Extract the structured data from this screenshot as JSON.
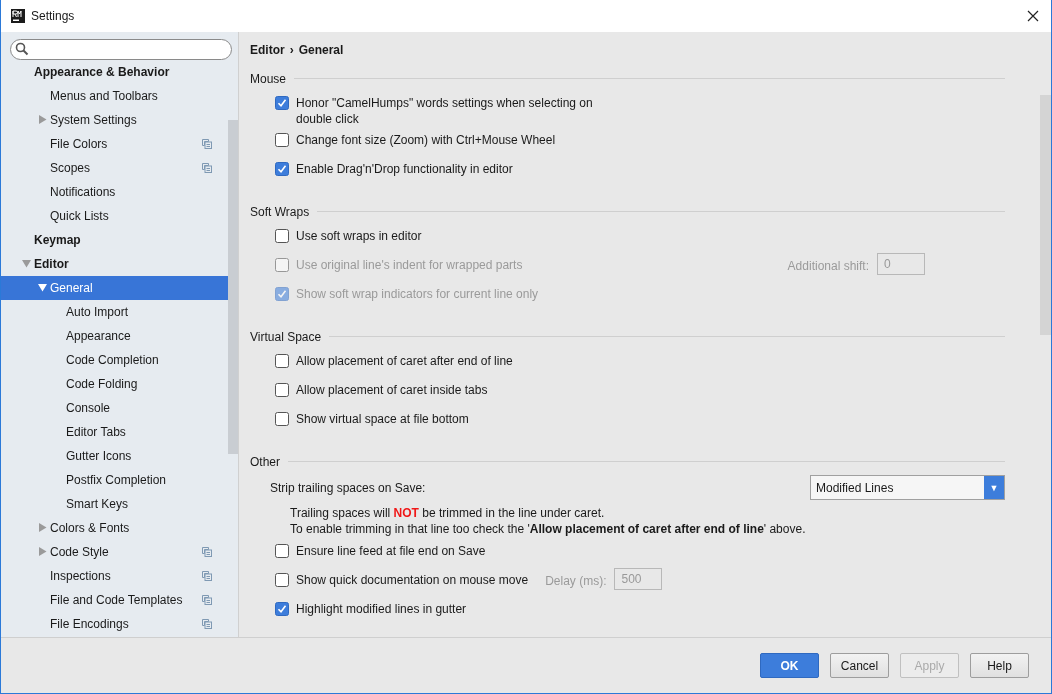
{
  "window": {
    "title": "Settings"
  },
  "sidebar": {
    "items": [
      {
        "label": "Appearance & Behavior",
        "children": [
          {
            "label": "Menus and Toolbars",
            "project_level": false
          },
          {
            "label": "System Settings",
            "expanded": false,
            "project_level": false
          },
          {
            "label": "File Colors",
            "project_level": true
          },
          {
            "label": "Scopes",
            "project_level": true
          },
          {
            "label": "Notifications",
            "project_level": false
          },
          {
            "label": "Quick Lists",
            "project_level": false
          }
        ]
      },
      {
        "label": "Keymap"
      },
      {
        "label": "Editor",
        "expanded": true,
        "children": [
          {
            "label": "General",
            "expanded": true,
            "selected": true,
            "project_level": false,
            "children": [
              {
                "label": "Auto Import",
                "selected": false
              },
              {
                "label": "Appearance",
                "selected": false
              },
              {
                "label": "Code Completion",
                "selected": false
              },
              {
                "label": "Code Folding",
                "selected": false
              },
              {
                "label": "Console",
                "selected": false
              },
              {
                "label": "Editor Tabs",
                "selected": false
              },
              {
                "label": "Gutter Icons",
                "selected": false
              },
              {
                "label": "Postfix Completion",
                "selected": false
              },
              {
                "label": "Smart Keys",
                "selected": false
              }
            ]
          },
          {
            "label": "Colors & Fonts",
            "expanded": false,
            "selected": false,
            "project_level": false
          },
          {
            "label": "Code Style",
            "expanded": false,
            "selected": false,
            "project_level": true
          },
          {
            "label": "Inspections",
            "selected": false,
            "project_level": true
          },
          {
            "label": "File and Code Templates",
            "selected": false,
            "project_level": true
          },
          {
            "label": "File Encodings",
            "selected": false,
            "project_level": true
          }
        ]
      }
    ]
  },
  "breadcrumb": {
    "parent": "Editor",
    "separator": "›",
    "current": "General"
  },
  "sections": [
    {
      "title": "Mouse",
      "options": [
        {
          "kind": "checkbox",
          "label": "Honor \"CamelHumps\" words settings when selecting on double click",
          "checked": true,
          "disabled": false
        },
        {
          "kind": "checkbox",
          "label": "Change font size (Zoom) with Ctrl+Mouse Wheel",
          "checked": false,
          "disabled": false
        },
        {
          "kind": "checkbox",
          "label": "Enable Drag'n'Drop functionality in editor",
          "checked": true,
          "disabled": false
        }
      ]
    },
    {
      "title": "Soft Wraps",
      "options": [
        {
          "kind": "checkbox",
          "label": "Use soft wraps in editor",
          "checked": false,
          "disabled": false
        },
        {
          "kind": "checkbox",
          "label": "Use original line's indent for wrapped parts",
          "checked": false,
          "disabled": true,
          "field": {
            "label": "Additional shift:",
            "value": "0",
            "disabled": true
          }
        },
        {
          "kind": "checkbox",
          "label": "Show soft wrap indicators for current line only",
          "checked": true,
          "disabled": true
        }
      ]
    },
    {
      "title": "Virtual Space",
      "options": [
        {
          "kind": "checkbox",
          "label": "Allow placement of caret after end of line",
          "checked": false,
          "disabled": false
        },
        {
          "kind": "checkbox",
          "label": "Allow placement of caret inside tabs",
          "checked": false,
          "disabled": false
        },
        {
          "kind": "checkbox",
          "label": "Show virtual space at file bottom",
          "checked": false,
          "disabled": false
        }
      ]
    },
    {
      "title": "Other",
      "options": [
        {
          "kind": "select",
          "label": "Strip trailing spaces on Save:",
          "value": "Modified Lines",
          "caret": "▼"
        },
        {
          "kind": "note",
          "alert": true,
          "text": "Trailing spaces will **NOT** be trimmed in the line under caret."
        },
        {
          "kind": "note",
          "alert": false,
          "text": "To enable trimming in that line too check the '**Allow placement of caret after end of line**' above."
        },
        {
          "kind": "checkbox",
          "label": "Ensure line feed at file end on Save",
          "checked": false,
          "disabled": false
        },
        {
          "kind": "checkbox",
          "label": "Show quick documentation on mouse move",
          "checked": false,
          "disabled": false,
          "field": {
            "label": "Delay (ms):",
            "value": "500",
            "disabled": true
          }
        },
        {
          "kind": "checkbox",
          "label": "Highlight modified lines in gutter",
          "checked": true,
          "disabled": false
        }
      ]
    }
  ],
  "buttons": [
    {
      "label": "OK",
      "default": true,
      "disabled": false
    },
    {
      "label": "Cancel",
      "default": false,
      "disabled": false
    },
    {
      "label": "Apply",
      "default": false,
      "disabled": true
    },
    {
      "label": "Help",
      "default": false,
      "disabled": false
    }
  ]
}
